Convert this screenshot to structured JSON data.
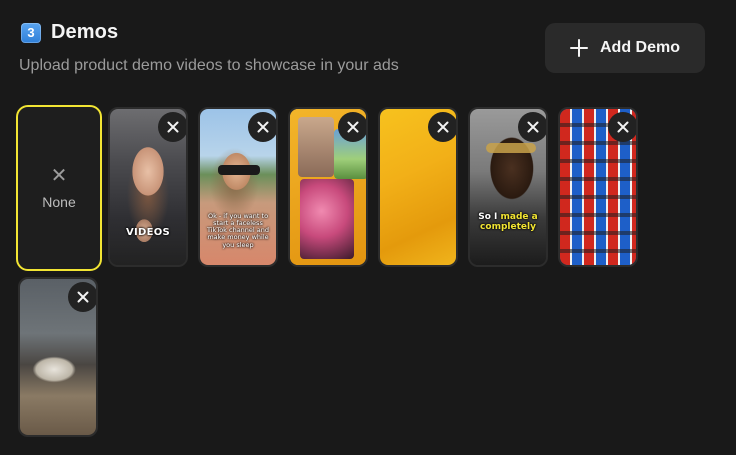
{
  "header": {
    "step_badge": "3",
    "title": "Demos",
    "subtitle": "Upload product demo videos to showcase in your ads"
  },
  "add_button": {
    "label": "Add Demo",
    "icon": "plus-icon"
  },
  "none_option": {
    "label": "None",
    "icon": "close-icon",
    "selected": true
  },
  "videos": [
    {
      "caption": "VIDEOS"
    },
    {
      "caption": "Ok - if you want to start a faceless TikTok channel and make money while you sleep"
    },
    {
      "caption": ""
    },
    {
      "caption": ""
    },
    {
      "caption_plain": "So I",
      "caption_highlight": "made a completely"
    },
    {
      "caption": ""
    },
    {
      "caption": ""
    }
  ],
  "colors": {
    "background": "#191919",
    "selected_border": "#f2e533",
    "button_bg": "#2a2a2a",
    "badge_blue": "#2f7fd8",
    "caption_yellow": "#f2e533"
  }
}
